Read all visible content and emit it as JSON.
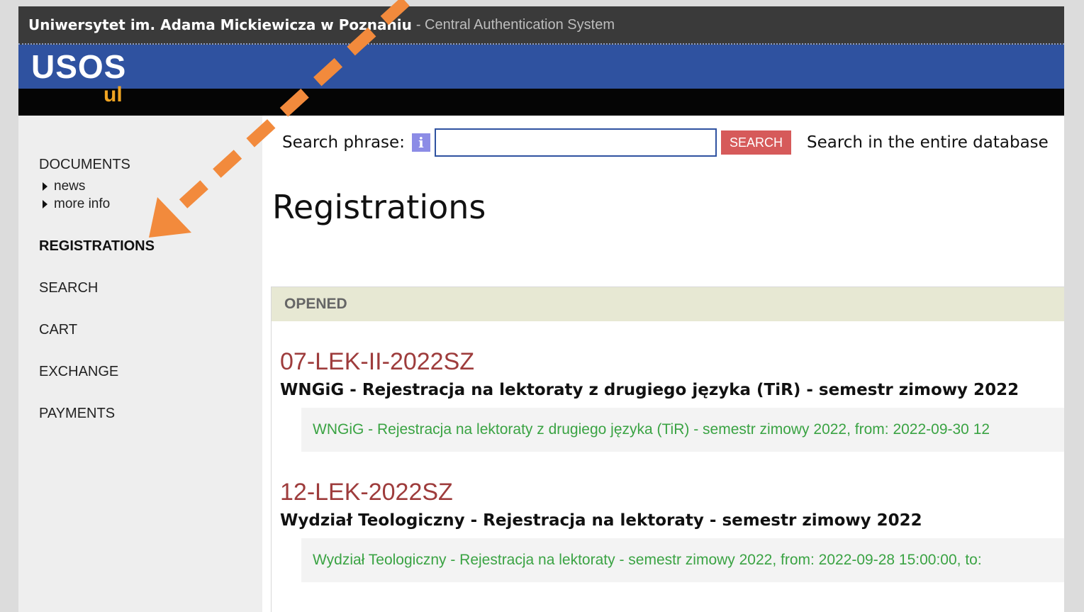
{
  "topbar": {
    "university": "Uniwersytet im. Adama Mickiewicza w Poznaniu",
    "system": "- Central Authentication System"
  },
  "brand": {
    "logo_main": "USOS",
    "logo_sub": "ul"
  },
  "sidebar": {
    "documents": "DOCUMENTS",
    "documents_sub": [
      "news",
      "more info"
    ],
    "registrations": "REGISTRATIONS",
    "search": "SEARCH",
    "cart": "CART",
    "exchange": "EXCHANGE",
    "payments": "PAYMENTS"
  },
  "search": {
    "label": "Search phrase:",
    "info_glyph": "i",
    "input_value": "",
    "button_label": "SEARCH",
    "entire_label": "Search in the entire database"
  },
  "page": {
    "title": "Registrations"
  },
  "panel": {
    "header": "OPENED",
    "registrations": [
      {
        "code": "07-LEK-II-2022SZ",
        "title": "WNGiG - Rejestracja na lektoraty z drugiego języka (TiR) - semestr zimowy 2022",
        "detail": "WNGiG - Rejestracja na lektoraty z drugiego języka (TiR) - semestr zimowy 2022, from: 2022-09-30 12"
      },
      {
        "code": "12-LEK-2022SZ",
        "title": "Wydział Teologiczny - Rejestracja na lektoraty - semestr zimowy 2022",
        "detail": "Wydział Teologiczny - Rejestracja na lektoraty - semestr zimowy 2022, from: 2022-09-28 15:00:00, to:"
      }
    ]
  },
  "colors": {
    "annotation_arrow": "#f28a3c",
    "brand_blue": "#2f52a0",
    "logo_accent": "#f0a422",
    "code_red": "#9e3c3c",
    "detail_green": "#3aa343"
  }
}
